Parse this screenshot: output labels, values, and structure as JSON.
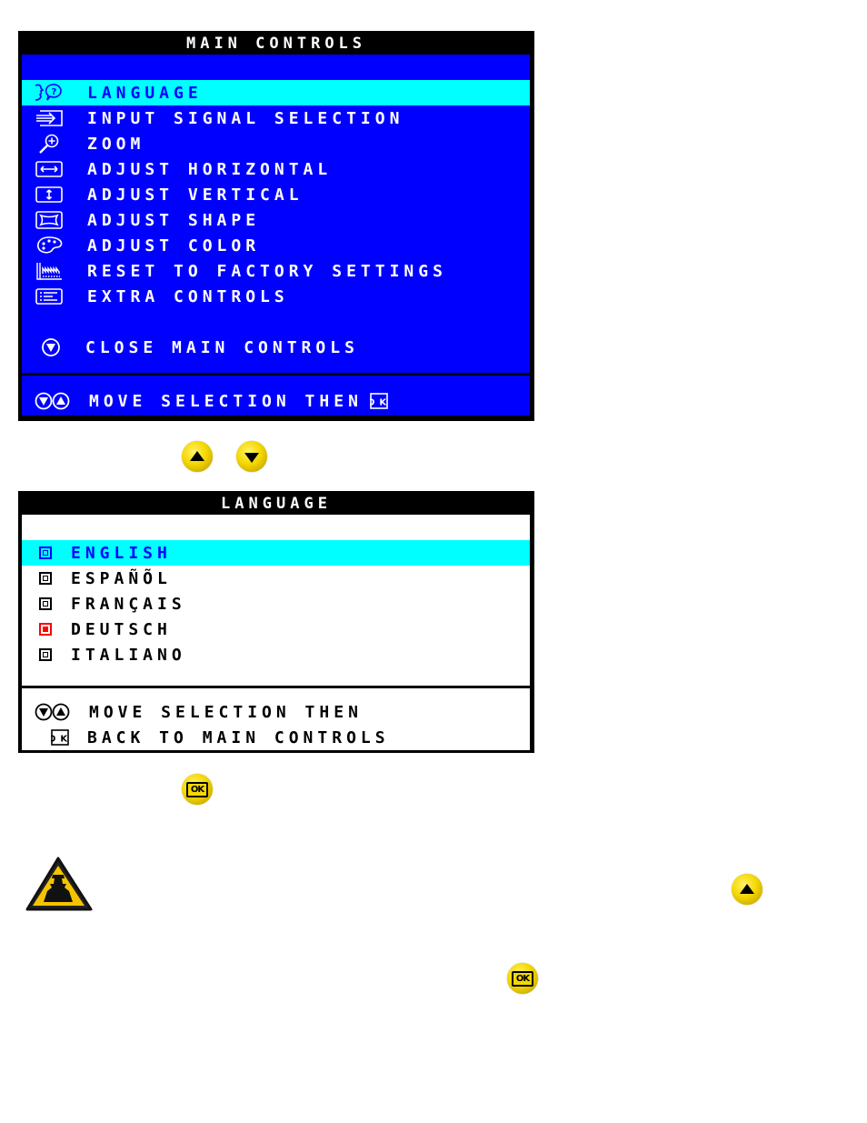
{
  "main_controls": {
    "title": "MAIN CONTROLS",
    "items": [
      {
        "label": "LANGUAGE",
        "icon": "language-icon",
        "selected": true
      },
      {
        "label": "INPUT SIGNAL SELECTION",
        "icon": "input-signal-icon",
        "selected": false
      },
      {
        "label": "ZOOM",
        "icon": "zoom-icon",
        "selected": false
      },
      {
        "label": "ADJUST HORIZONTAL",
        "icon": "horizontal-arrows-icon",
        "selected": false
      },
      {
        "label": "ADJUST VERTICAL",
        "icon": "vertical-arrows-icon",
        "selected": false
      },
      {
        "label": "ADJUST SHAPE",
        "icon": "shape-icon",
        "selected": false
      },
      {
        "label": "ADJUST COLOR",
        "icon": "palette-icon",
        "selected": false
      },
      {
        "label": "RESET TO FACTORY SETTINGS",
        "icon": "factory-icon",
        "selected": false
      },
      {
        "label": "EXTRA CONTROLS",
        "icon": "extra-controls-icon",
        "selected": false
      }
    ],
    "close_label": "CLOSE MAIN CONTROLS",
    "footer": "MOVE SELECTION THEN",
    "ok_glyph": "OK"
  },
  "nav_buttons": {
    "up": "up-button",
    "down": "down-button"
  },
  "language": {
    "title": "LANGUAGE",
    "items": [
      {
        "label": "ENGLISH",
        "state": "highlighted"
      },
      {
        "label": "ESPAÑÕL",
        "state": "normal"
      },
      {
        "label": "FRANÇAIS",
        "state": "normal"
      },
      {
        "label": "DEUTSCH",
        "state": "active"
      },
      {
        "label": "ITALIANO",
        "state": "normal"
      }
    ],
    "footer_line1": "MOVE SELECTION THEN",
    "footer_line2": "BACK TO MAIN CONTROLS",
    "ok_glyph": "OK"
  },
  "ok_button_label": "OK",
  "colors": {
    "osd_blue": "#0000ff",
    "highlight_cyan": "#00ffff",
    "active_red": "#ff0000",
    "button_yellow": "#f4d800"
  }
}
